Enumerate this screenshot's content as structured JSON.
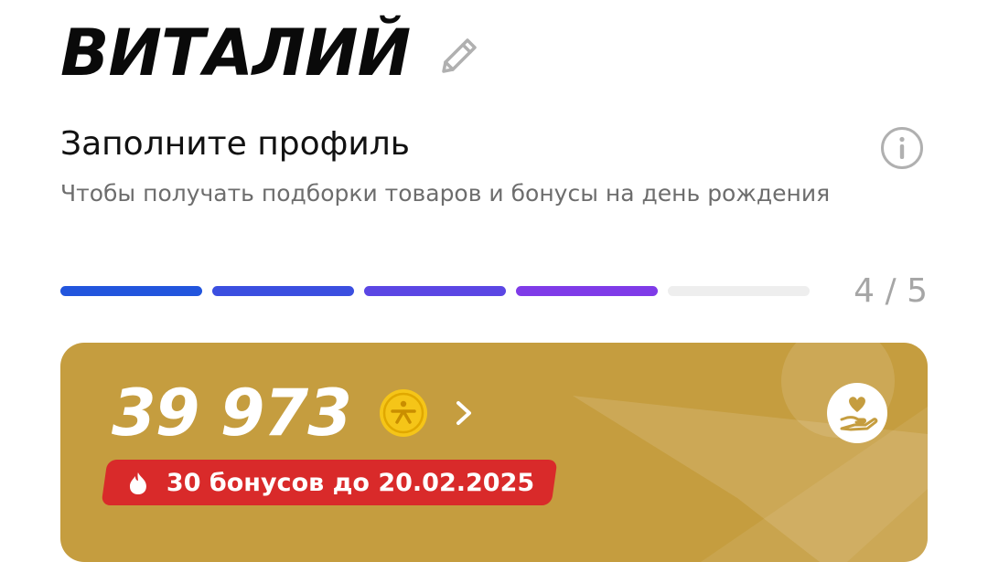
{
  "user": {
    "name": "ВИТАЛИЙ",
    "edit_icon": "pencil-icon"
  },
  "profile": {
    "title": "Заполните профиль",
    "subtitle": "Чтобы получать подборки товаров и бонусы на день рождения",
    "info_icon": "info-icon",
    "progress": {
      "completed": 4,
      "total": 5,
      "label": "4 / 5",
      "segment_colors": [
        "#2255dd",
        "#3b4fe0",
        "#5b46e4",
        "#7f3be8"
      ],
      "empty_color": "#eeeeee"
    }
  },
  "bonus_card": {
    "balance": "39 973",
    "coin_icon": "coin-icon",
    "chevron_icon": "chevron-right-icon",
    "action_icon": "heart-hand-icon",
    "expire_text": "30 бонусов до 20.02.2025",
    "expire_icon": "flame-icon",
    "colors": {
      "card": "#c59d3f",
      "badge": "#d92a2a",
      "coin": "#f5c518"
    }
  }
}
